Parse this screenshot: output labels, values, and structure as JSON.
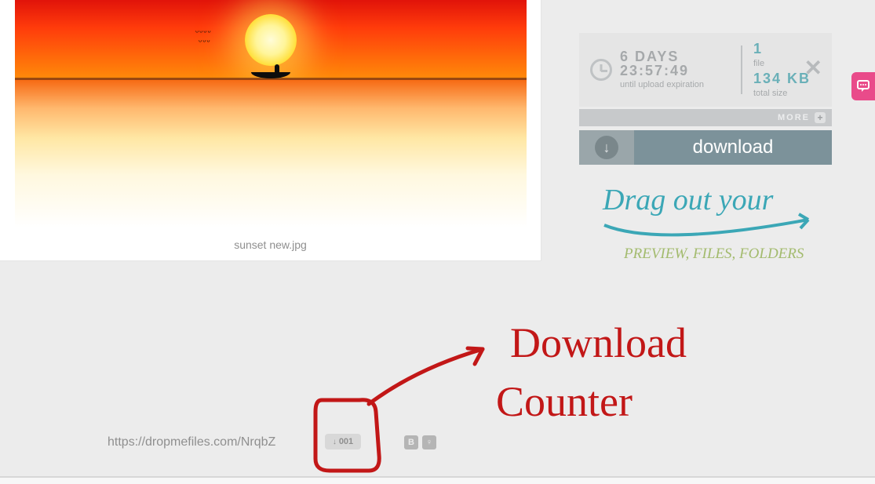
{
  "preview": {
    "filename": "sunset new.jpg"
  },
  "info": {
    "days_line": "6 DAYS",
    "time_line": "23:57:49",
    "expiration_label": "until upload expiration",
    "file_count": "1",
    "file_count_label": "file",
    "total_size": "134 KB",
    "total_size_label": "total size"
  },
  "more_label": "MORE",
  "download_label": "download",
  "drag_hint_top": "Drag out your",
  "drag_hint_bottom": "PREVIEW, FILES, FOLDERS",
  "share_url": "https://dropmefiles.com/NrqbZ",
  "download_count": "001",
  "social": {
    "b_label": "B",
    "ok_label": "♀"
  },
  "annotation": {
    "line1": "Download",
    "line2": "Counter"
  }
}
